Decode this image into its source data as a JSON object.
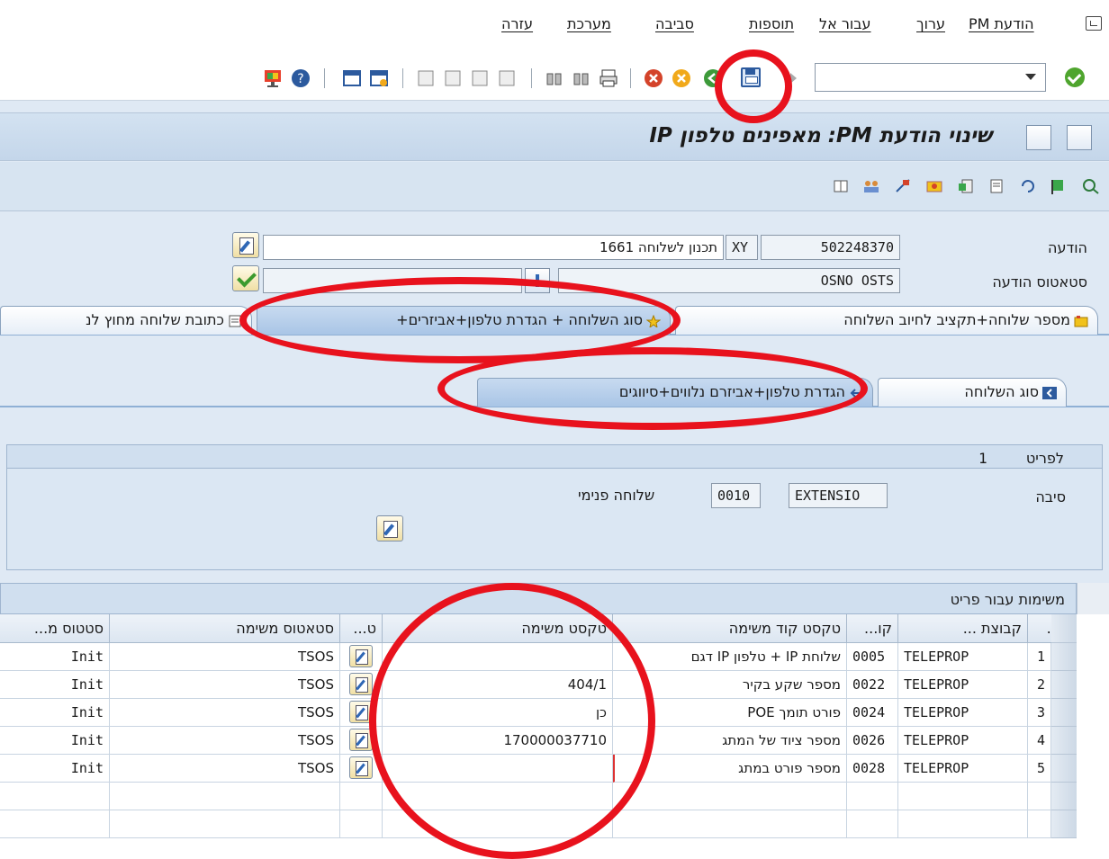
{
  "menu": {
    "items": [
      "הודעת PM",
      "ערוך",
      "עבור אל",
      "תוספות",
      "סביבה",
      "מערכת",
      "עזרה"
    ]
  },
  "toolbar": {
    "command_field_value": "",
    "icons": [
      "enter-check-icon",
      "save-icon",
      "back-icon",
      "exit-icon",
      "cancel-icon",
      "print-icon",
      "find-icon",
      "find-next-icon",
      "first-page-icon",
      "previous-page-icon",
      "next-page-icon",
      "last-page-icon",
      "create-session-icon",
      "shortcut-icon",
      "help-icon",
      "customize-layout-icon"
    ]
  },
  "title": {
    "text": "שינוי הודעת PM: מאפינים טלפון IP"
  },
  "header": {
    "notification_label": "הודעה",
    "notification_number": "502248370",
    "notification_type": "XY",
    "notification_desc": "תכנון לשלוחה 1661",
    "status_label": "סטאטוס הודעה",
    "status_value": "OSNO OSTS",
    "status_extra": "",
    "status_extra2": ""
  },
  "tabs": [
    {
      "label": "מספר שלוחה+תקציב לחיוב השלוחה",
      "active": false
    },
    {
      "label": "סוג השלוחה + הגדרת טלפון+אביזרים+",
      "active": true
    },
    {
      "label": "כתובת שלוחה מחוץ לנ",
      "active": false
    }
  ],
  "subtabs": [
    {
      "label": "סוג השלוחה",
      "active": false
    },
    {
      "label": "הגדרת טלפון+אביזרם נלווים+סיווגים",
      "active": true
    }
  ],
  "item": {
    "item_label": "לפריט",
    "item_number": "1",
    "cause_label": "סיבה",
    "cause_value": "EXTENSIO",
    "cause_code": "0010",
    "cause_text": "שלוחה פנימי"
  },
  "tasks_table": {
    "title": "משימות עבור פריט",
    "headers": [
      "מס.",
      "קבוצת ...",
      "קו...",
      "טקסט קוד משימה",
      "טקסט משימה",
      "ט...",
      "סטאטוס משימה",
      "סטטוס מ..."
    ],
    "rows": [
      {
        "no": "1",
        "group": "TELEPROP",
        "code": "0005",
        "code_text": "שלוחת IP + טלפון IP דגם",
        "task_text": "",
        "status": "TSOS",
        "user_status": "Init"
      },
      {
        "no": "2",
        "group": "TELEPROP",
        "code": "0022",
        "code_text": "מספר שקע בקיר",
        "task_text": "404/1",
        "status": "TSOS",
        "user_status": "Init"
      },
      {
        "no": "3",
        "group": "TELEPROP",
        "code": "0024",
        "code_text": "פורט תומך POE",
        "task_text": "כן",
        "status": "TSOS",
        "user_status": "Init"
      },
      {
        "no": "4",
        "group": "TELEPROP",
        "code": "0026",
        "code_text": "מספר ציוד של המתג",
        "task_text": "170000037710",
        "status": "TSOS",
        "user_status": "Init"
      },
      {
        "no": "5",
        "group": "TELEPROP",
        "code": "0028",
        "code_text": "מספר פורט במתג",
        "task_text": "",
        "status": "TSOS",
        "user_status": "Init"
      }
    ]
  },
  "colors": {
    "annotation_red": "#e8121d",
    "sap_blue_bg": "#dfe9f4",
    "active_tab": "#a9c5e6"
  }
}
